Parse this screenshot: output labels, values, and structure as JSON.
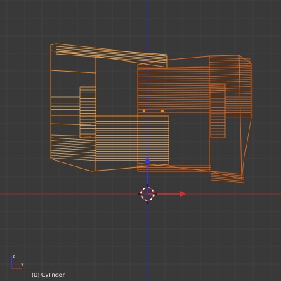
{
  "viewport": {
    "object_label": "(0) Cylinder",
    "colors": {
      "background": "#393939",
      "grid_line": "#414141",
      "x_axis": "#9b2a2a",
      "y_axis": "#2a2ab5",
      "wire_selected": "#f28a1c",
      "wire_selected_active": "#e86412",
      "wire_light": "#f6b566"
    }
  },
  "axis_widget": {
    "icon": "view-axis-icon",
    "x_label": "x",
    "y_label": "z"
  },
  "cursor_3d": {
    "icon": "3d-cursor-icon"
  },
  "manipulator": {
    "icon": "transform-manipulator-icon"
  }
}
